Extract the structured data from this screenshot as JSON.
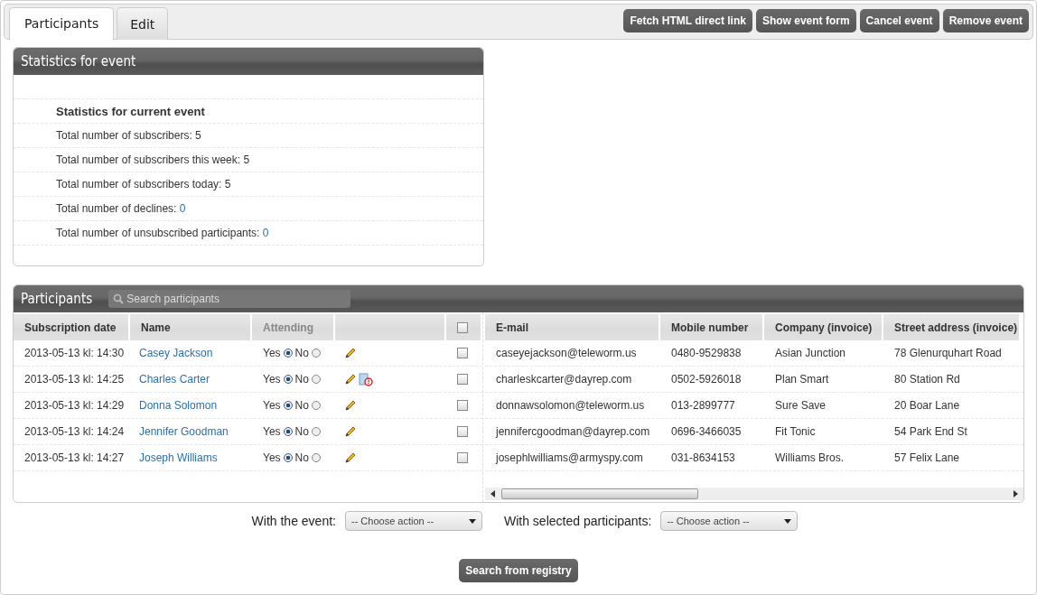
{
  "tabs": [
    {
      "label": "Participants",
      "selected": true
    },
    {
      "label": "Edit",
      "selected": false
    }
  ],
  "actions": [
    "Fetch HTML direct link",
    "Show event form",
    "Cancel event",
    "Remove event"
  ],
  "statistics": {
    "title": "Statistics for event",
    "heading": "Statistics for current event",
    "items": [
      {
        "label": "Total number of subscribers:",
        "value": "5",
        "linked": false
      },
      {
        "label": "Total number of subscribers this week:",
        "value": "5",
        "linked": false
      },
      {
        "label": "Total number of subscribers today:",
        "value": "5",
        "linked": false
      },
      {
        "label": "Total number of declines:",
        "value": "0",
        "linked": true
      },
      {
        "label": "Total number of unsubscribed participants:",
        "value": "0",
        "linked": true
      }
    ]
  },
  "participants": {
    "title": "Participants",
    "search": {
      "placeholder": "Search participants"
    },
    "columns": [
      "Subscription date",
      "Name",
      "Attending",
      "E-mail",
      "Mobile number",
      "Company (invoice)",
      "Street address (invoice)"
    ],
    "select_all": {
      "checked": false
    },
    "rows": [
      {
        "date": "2013-05-13 kl: 14:30",
        "name": "Casey Jackson",
        "yes_label": "Yes",
        "no_label": "No",
        "attending": true,
        "warning": false,
        "checked": false,
        "email": "caseyejackson@teleworm.us",
        "mobile": "0480-9529838",
        "company": "Asian Junction",
        "street": "78 Glenurquhart Road"
      },
      {
        "date": "2013-05-13 kl: 14:25",
        "name": "Charles Carter",
        "yes_label": "Yes",
        "no_label": "No",
        "attending": true,
        "warning": true,
        "checked": false,
        "email": "charleskcarter@dayrep.com",
        "mobile": "0502-5926018",
        "company": "Plan Smart",
        "street": "80 Station Rd"
      },
      {
        "date": "2013-05-13 kl: 14:29",
        "name": "Donna Solomon",
        "yes_label": "Yes",
        "no_label": "No",
        "attending": true,
        "warning": false,
        "checked": false,
        "email": "donnawsolomon@teleworm.us",
        "mobile": "013-2899777",
        "company": "Sure Save",
        "street": "20 Boar Lane"
      },
      {
        "date": "2013-05-13 kl: 14:24",
        "name": "Jennifer Goodman",
        "yes_label": "Yes",
        "no_label": "No",
        "attending": true,
        "warning": false,
        "checked": false,
        "email": "jennifercgoodman@dayrep.com",
        "mobile": "0696-3466035",
        "company": "Fit Tonic",
        "street": "54 Park End St"
      },
      {
        "date": "2013-05-13 kl: 14:27",
        "name": "Joseph Williams",
        "yes_label": "Yes",
        "no_label": "No",
        "attending": true,
        "warning": false,
        "checked": false,
        "email": "josephlwilliams@armyspy.com",
        "mobile": "031-8634153",
        "company": "Williams Bros.",
        "street": "57 Felix Lane"
      }
    ]
  },
  "bulk": [
    {
      "label": "With the event:",
      "value": "-- Choose action --"
    },
    {
      "label": "With selected participants:",
      "value": "-- Choose action --"
    }
  ],
  "registry_button": "Search from registry"
}
